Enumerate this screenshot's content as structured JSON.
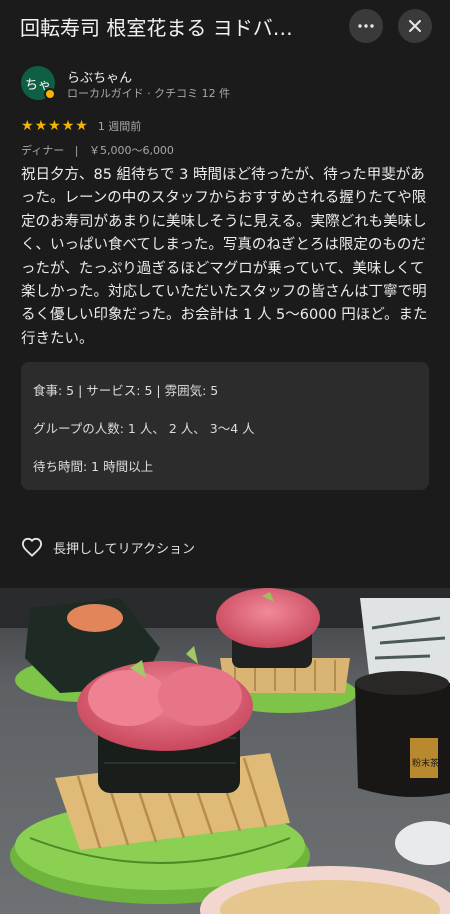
{
  "header": {
    "title": "回転寿司 根室花まる ヨドバ…",
    "more_icon": "more-horizontal-icon",
    "close_icon": "close-icon"
  },
  "author": {
    "avatar_text": "ちゃ",
    "name": "らぶちゃん",
    "subtitle": "ローカルガイド · クチコミ 12 件"
  },
  "review": {
    "stars": 5,
    "star_glyph": "★",
    "date": "1 週間前",
    "meal_type": "ディナー",
    "separator": "|",
    "price": "￥5,000～6,000",
    "text": "祝日夕方、85 組待ちで 3 時間ほど待ったが、待った甲斐があった。レーンの中のスタッフからおすすめされる握りたてや限定のお寿司があまりに美味しそうに見える。実際どれも美味しく、いっぱい食べてしまった。写真のねぎとろは限定のものだったが、たっぷり過ぎるほどマグロが乗っていて、美味しくて楽しかった。対応していただいたスタッフの皆さんは丁寧で明るく優しい印象だった。お会計は 1 人 5～6000 円ほど。また行きたい。"
  },
  "details": {
    "ratings": "食事: 5 | サービス: 5 | 雰囲気: 5",
    "group_size": "グループの人数: 1 人、 2 人、 3～4 人",
    "wait_time": "待ち時間: 1 時間以上"
  },
  "reaction": {
    "icon": "heart-outline-icon",
    "label": "長押ししてリアクション"
  },
  "photo": {
    "label_text": "粉末茶"
  },
  "colors": {
    "background": "#1b1b1b",
    "star": "#f4b400",
    "avatar": "#0f5f45",
    "card": "#2c2c2c"
  }
}
